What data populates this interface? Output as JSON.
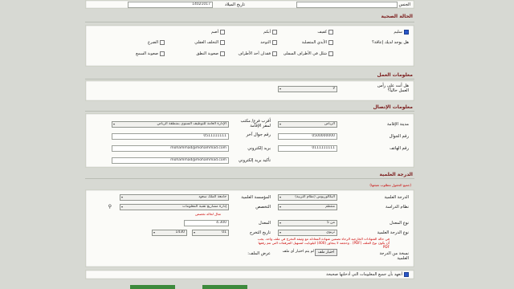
{
  "top": {
    "id_date_label": "تاريخ الميلاد",
    "id_value": "14021017",
    "gender_label": "الجنس"
  },
  "health": {
    "title": "الحالة الصحية",
    "options": [
      "سليم",
      "كفيف",
      "أبكم",
      "أصم",
      "هل يوجد لديك إعاقة؟",
      "الأيدي المتصلبة",
      "التوحد",
      "التخلف العقلي",
      "الضرع",
      "شلل في الأطراف السفلى",
      "فقدان أحد الأطراف",
      "صعوبة النطق",
      "صعوبة السمع"
    ]
  },
  "work": {
    "title": "معلومات العمل",
    "question": "هل أنت على رأس العمل حالياً؟",
    "value": "لا"
  },
  "contact": {
    "title": "معلومات الإتصال",
    "city_label": "مدينة الإقامة",
    "city_value": "الرياض",
    "office_label": "أقرب فرع/ مكتب لمقر الإقامة",
    "office_value": "الإدارة العامة للتوظيف السنوي بمنطقة الرياض",
    "mobile_label": "رقم الجوال",
    "mobile_value": "0500000000",
    "alt_mobile_label": "رقم جوال آخر",
    "alt_mobile_value": "0511111111",
    "phone_label": "رقم الهاتف",
    "phone_value": "0111111111",
    "email_label": "بريد إلكتروني",
    "email_value": "mohammad@mohammad.com",
    "email_confirm_label": "تأكيد بريد إلكتروني",
    "email_confirm_value": "mohammad@mohammad.com"
  },
  "degree": {
    "title": "الدرجة العلمية",
    "required_note": "(جميع الحقول مطلوب تعبئتها)",
    "degree_label": "الدرجة العلمية",
    "degree_value": "البكالوريوس (نظام التربية)",
    "institution_label": "المؤسسة العلمية",
    "institution_value": "جامعة الملك سعود",
    "study_system_label": "نظام الدراسة",
    "study_system_value": "منتظم",
    "major_label": "التخصص",
    "major_value": "إدارة مشاريع تقنية المعلومات",
    "gpa_type_label": "نوع المعدل",
    "gpa_type_value": "من 5",
    "gpa_label": "المعدل",
    "gpa_value": "4.300",
    "gpa_hint": "مثال لحالة تخصص",
    "degree_type_label": "نوع الدرجة العلمية",
    "degree_type_value": "تربوي",
    "grad_date_label": "تاريخ التخرج",
    "grad_month": "01",
    "grad_year": "1430",
    "note": "في حالة الشهادات الخارجية الرجاء تضمين شهادة المعادلة مع وثيقة التخرج في ملف واحد. يجب أن يكون نوع الملف (PDF) . وحجمه لا يتجاوز (400) كيلوبايت لتسهيل المرفقات التي تتم رفعها PDF",
    "copy_label": "نسخة من الدرجة العلمية",
    "upload_button": "اختيار ملف",
    "no_file": "لم يتم اختيار أي ملف",
    "view_label": "عرض الملف:"
  },
  "pledge": "أتعهد بأن جميع المعلومات التي أدخلتها صحيحة"
}
